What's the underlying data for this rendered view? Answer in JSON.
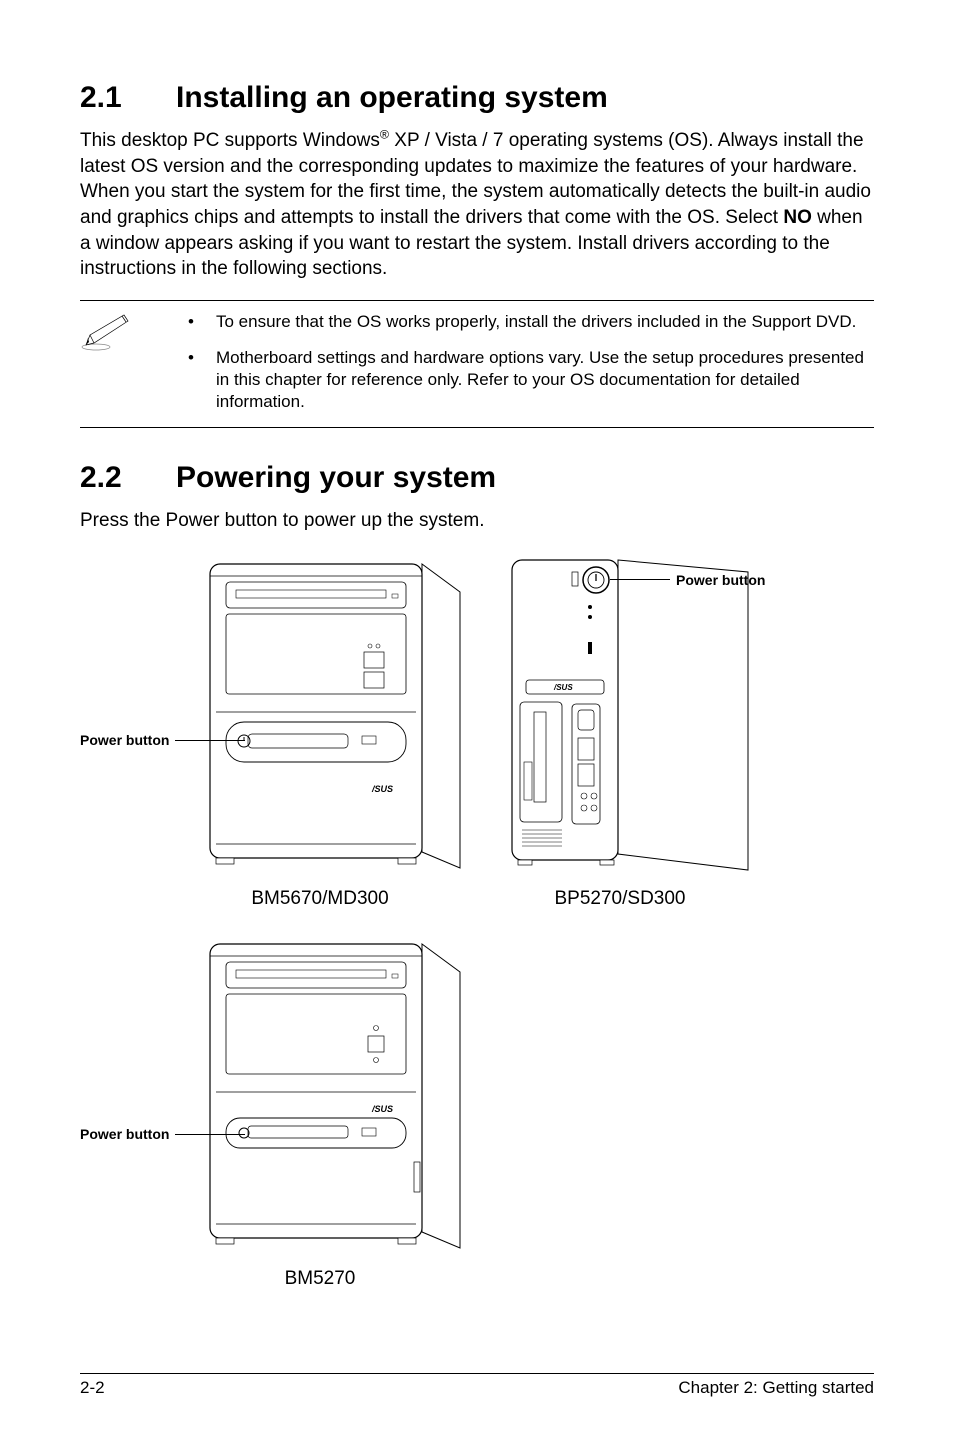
{
  "section1": {
    "number": "2.1",
    "title": "Installing an operating system",
    "body_pre": "This desktop PC supports Windows",
    "body_sup": "®",
    "body_mid": " XP / Vista / 7 operating systems (OS). Always install the latest OS version and the corresponding updates to maximize the features of your hardware. When you start the system for the first time, the system automatically detects the built-in audio and graphics chips and attempts to install the drivers that come with the OS. Select ",
    "body_bold": "NO",
    "body_post": " when a window appears asking if you want to restart the system. Install drivers according to the instructions in the following sections."
  },
  "notes": {
    "bullet": "•",
    "item1": "To ensure that the OS works properly, install the drivers included in the Support DVD.",
    "item2": "Motherboard settings and hardware options vary. Use the setup procedures presented in this chapter for reference only. Refer to your OS documentation for detailed information."
  },
  "section2": {
    "number": "2.2",
    "title": "Powering your system",
    "body": "Press the Power button to power up the system."
  },
  "figures": {
    "power_button_label": "Power button",
    "caption1": "BM5670/MD300",
    "caption2": "BP5270/SD300",
    "caption3": "BM5270"
  },
  "footer": {
    "left": "2-2",
    "right": "Chapter 2: Getting started"
  }
}
